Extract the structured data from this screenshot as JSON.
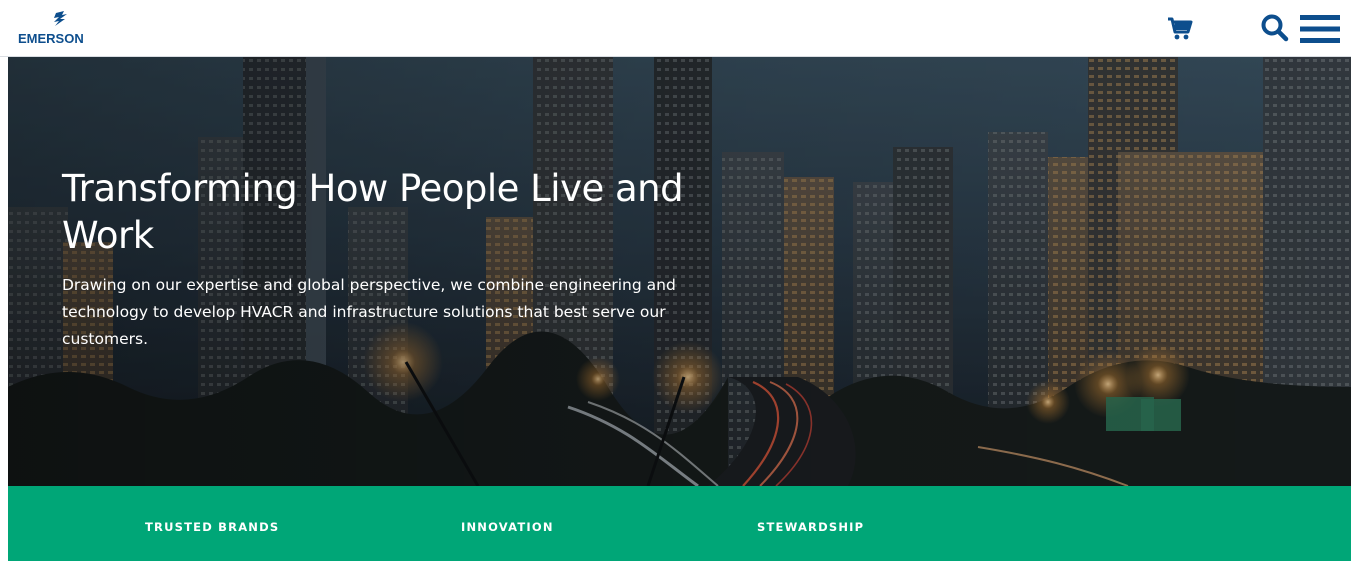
{
  "brand": {
    "logo_text": "EMERSON",
    "color": "#0d4e8d"
  },
  "header": {
    "icons": [
      "shopping-cart-icon",
      "search-icon",
      "hamburger-menu-icon"
    ]
  },
  "hero": {
    "title": "Transforming How People Live and Work",
    "subtitle": "Drawing on our expertise and global perspective, we combine engineering and technology to develop HVACR and infrastructure solutions that best serve our customers."
  },
  "pillars": {
    "background": "#00a677",
    "items": [
      {
        "label": "TRUSTED BRANDS"
      },
      {
        "label": "INNOVATION"
      },
      {
        "label": "STEWARDSHIP"
      }
    ]
  }
}
